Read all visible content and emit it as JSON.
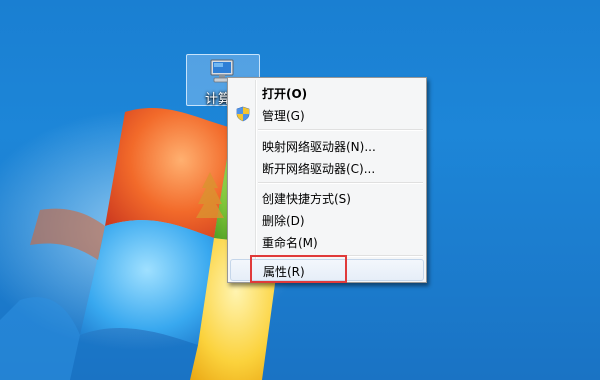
{
  "desktop": {
    "icon_label": "计算机",
    "icon_name": "computer-icon"
  },
  "context_menu": {
    "items": [
      {
        "label": "打开(O)",
        "bold": true
      },
      {
        "label": "管理(G)",
        "icon": "uac-shield-icon"
      },
      {
        "label": "映射网络驱动器(N)..."
      },
      {
        "label": "断开网络驱动器(C)..."
      },
      {
        "label": "创建快捷方式(S)"
      },
      {
        "label": "删除(D)"
      },
      {
        "label": "重命名(M)"
      },
      {
        "label": "属性(R)",
        "highlighted": true
      }
    ]
  },
  "colors": {
    "desktop_blue": "#1a7fd2",
    "annotation_red": "#e03a3a"
  }
}
